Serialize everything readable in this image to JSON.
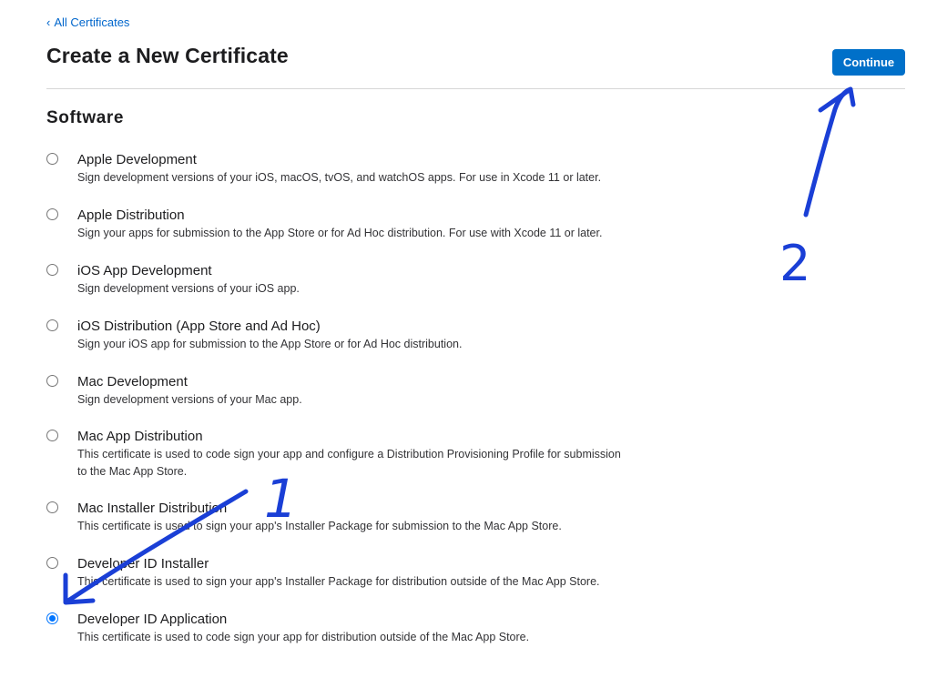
{
  "nav": {
    "back_label": "All Certificates"
  },
  "header": {
    "title": "Create a New Certificate",
    "continue_label": "Continue"
  },
  "section": {
    "heading": "Software"
  },
  "options": [
    {
      "title": "Apple Development",
      "description": "Sign development versions of your iOS, macOS, tvOS, and watchOS apps. For use in Xcode 11 or later.",
      "selected": false
    },
    {
      "title": "Apple Distribution",
      "description": "Sign your apps for submission to the App Store or for Ad Hoc distribution. For use with Xcode 11 or later.",
      "selected": false
    },
    {
      "title": "iOS App Development",
      "description": "Sign development versions of your iOS app.",
      "selected": false
    },
    {
      "title": "iOS Distribution (App Store and Ad Hoc)",
      "description": "Sign your iOS app for submission to the App Store or for Ad Hoc distribution.",
      "selected": false
    },
    {
      "title": "Mac Development",
      "description": "Sign development versions of your Mac app.",
      "selected": false
    },
    {
      "title": "Mac App Distribution",
      "description": "This certificate is used to code sign your app and configure a Distribution Provisioning Profile for submission to the Mac App Store.",
      "selected": false
    },
    {
      "title": "Mac Installer Distribution",
      "description": "This certificate is used to sign your app's Installer Package for submission to the Mac App Store.",
      "selected": false
    },
    {
      "title": "Developer ID Installer",
      "description": "This certificate is used to sign your app's Installer Package for distribution outside of the Mac App Store.",
      "selected": false
    },
    {
      "title": "Developer ID Application",
      "description": "This certificate is used to code sign your app for distribution outside of the Mac App Store.",
      "selected": true
    }
  ],
  "annotations": {
    "step1_label": "1",
    "step2_label": "2",
    "ink_color": "#1a3fd6"
  },
  "colors": {
    "accent": "#0070c9",
    "link": "#0066cc",
    "radio_selected": "#0075ff"
  }
}
